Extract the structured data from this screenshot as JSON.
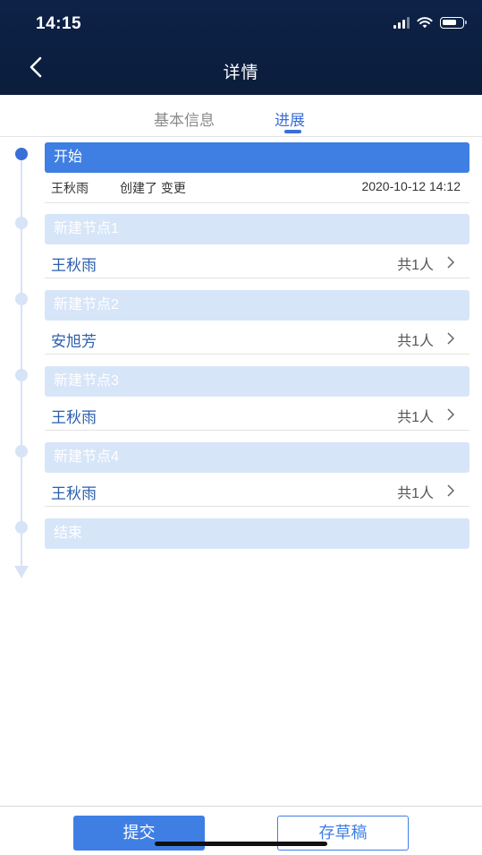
{
  "status_bar": {
    "time": "14:15"
  },
  "nav": {
    "title": "详情"
  },
  "tabs": [
    {
      "label": "基本信息",
      "active": false
    },
    {
      "label": "进展",
      "active": true
    }
  ],
  "timeline": {
    "start": {
      "label": "开始",
      "user": "王秋雨",
      "action": "创建了 变更",
      "time": "2020-10-12 14:12"
    },
    "nodes": [
      {
        "label": "新建节点1",
        "person": "王秋雨",
        "count": "共1人"
      },
      {
        "label": "新建节点2",
        "person": "安旭芳",
        "count": "共1人"
      },
      {
        "label": "新建节点3",
        "person": "王秋雨",
        "count": "共1人"
      },
      {
        "label": "新建节点4",
        "person": "王秋雨",
        "count": "共1人"
      }
    ],
    "end": {
      "label": "结束"
    }
  },
  "actions": {
    "submit": "提交",
    "draft": "存草稿"
  },
  "colors": {
    "nav_bg": "#0c1d3d",
    "accent": "#3f7fe4",
    "node_inactive": "#d7e5f8",
    "name_text": "#2c5fae"
  },
  "icons": [
    "back-arrow-icon",
    "signal-icon",
    "wifi-icon",
    "battery-icon",
    "chevron-right-icon"
  ]
}
